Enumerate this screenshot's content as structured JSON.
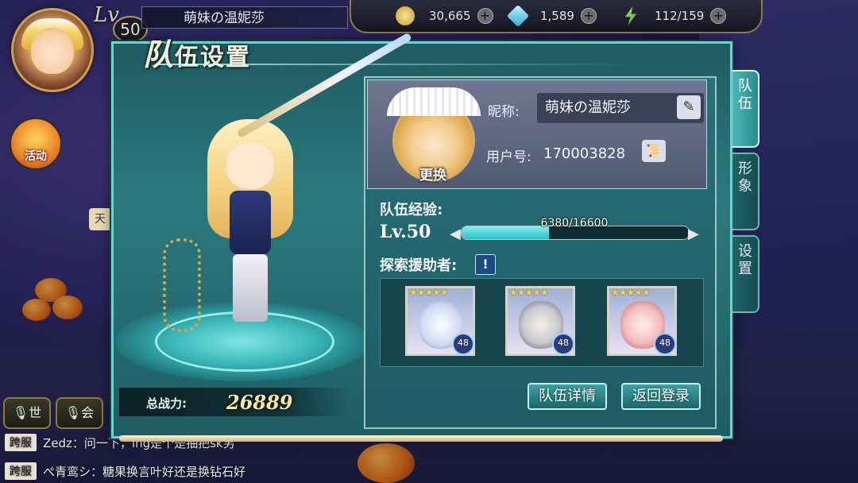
{
  "hud": {
    "lv_prefix": "Lv",
    "level": "50",
    "player_name": "萌妹の温妮莎",
    "gold": "30,665",
    "crystals": "1,589",
    "stamina": "112/159"
  },
  "left_widgets": {
    "activity_label": "活动",
    "partial_tab": "天"
  },
  "chat": {
    "world_btn": "世",
    "guild_btn": "会",
    "lines": [
      {
        "tag": "跨服",
        "text": "Zedz：问一下，ing是个是抽把sk另"
      },
      {
        "tag": "跨服",
        "text": "ぺ青鸾シ：糖果换言叶好还是换钻石好"
      }
    ]
  },
  "panel": {
    "title_first": "队",
    "title_rest": "伍设置",
    "power_label": "总战力:",
    "power_value": "26889"
  },
  "profile": {
    "change_label": "更换",
    "nickname_label": "昵称:",
    "nickname_value": "萌妹の温妮莎",
    "user_id_label": "用户号:",
    "user_id_value": "170003828"
  },
  "team_xp": {
    "label": "队伍经验:",
    "level_text": "Lv.50",
    "current": 6380,
    "max": 16600,
    "display": "6380/16600"
  },
  "helpers": {
    "label": "探索援助者:",
    "info_icon": "!",
    "items": [
      {
        "stars": "★★★★★",
        "level": "48",
        "color": "#a9c3e8"
      },
      {
        "stars": "★★★★★",
        "level": "48",
        "color": "#b9b9bd"
      },
      {
        "stars": "★★★★★",
        "level": "48",
        "color": "#f3b6b6"
      }
    ]
  },
  "buttons": {
    "team_details": "队伍详情",
    "back_to_login": "返回登录"
  },
  "tabs": {
    "team": "队\n伍",
    "appearance": "形\n象",
    "settings": "设\n置"
  }
}
